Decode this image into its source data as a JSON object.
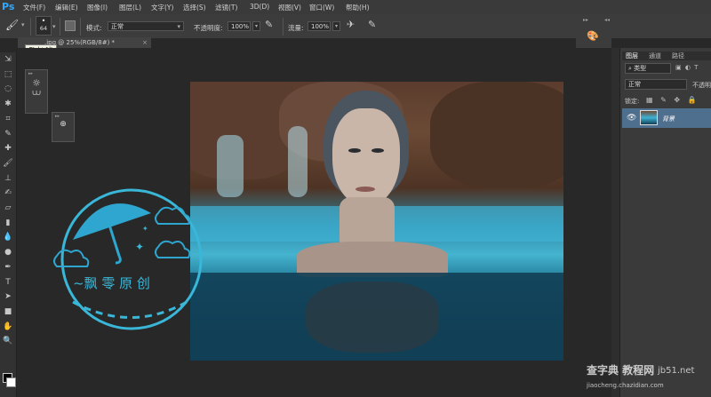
{
  "app": {
    "logo": "Ps"
  },
  "menu": [
    "文件(F)",
    "编辑(E)",
    "图像(I)",
    "图层(L)",
    "文字(Y)",
    "选择(S)",
    "滤镜(T)",
    "3D(D)",
    "视图(V)",
    "窗口(W)",
    "帮助(H)"
  ],
  "options": {
    "brush_size": "64",
    "mode_label": "模式:",
    "mode_value": "正常",
    "opacity_label": "不透明度:",
    "opacity_value": "100%",
    "flow_label": "流量:",
    "flow_value": "100%"
  },
  "document": {
    "tab_title": ".jpg @ 25%(RGB/8#) *",
    "tooltip": "Ctrl+Alt"
  },
  "watermark": {
    "text": "~飘 零 原 创"
  },
  "layers_panel": {
    "tabs": [
      "图层",
      "通道",
      "路径"
    ],
    "filter_label": "类型",
    "blend_mode": "正常",
    "opacity_label": "不透明",
    "lock_label": "锁定:",
    "layer_name": "背景"
  },
  "site": {
    "brand": "查字典 教程网",
    "domain": "jb51.net",
    "url": "jiaocheng.chazidian.com"
  }
}
